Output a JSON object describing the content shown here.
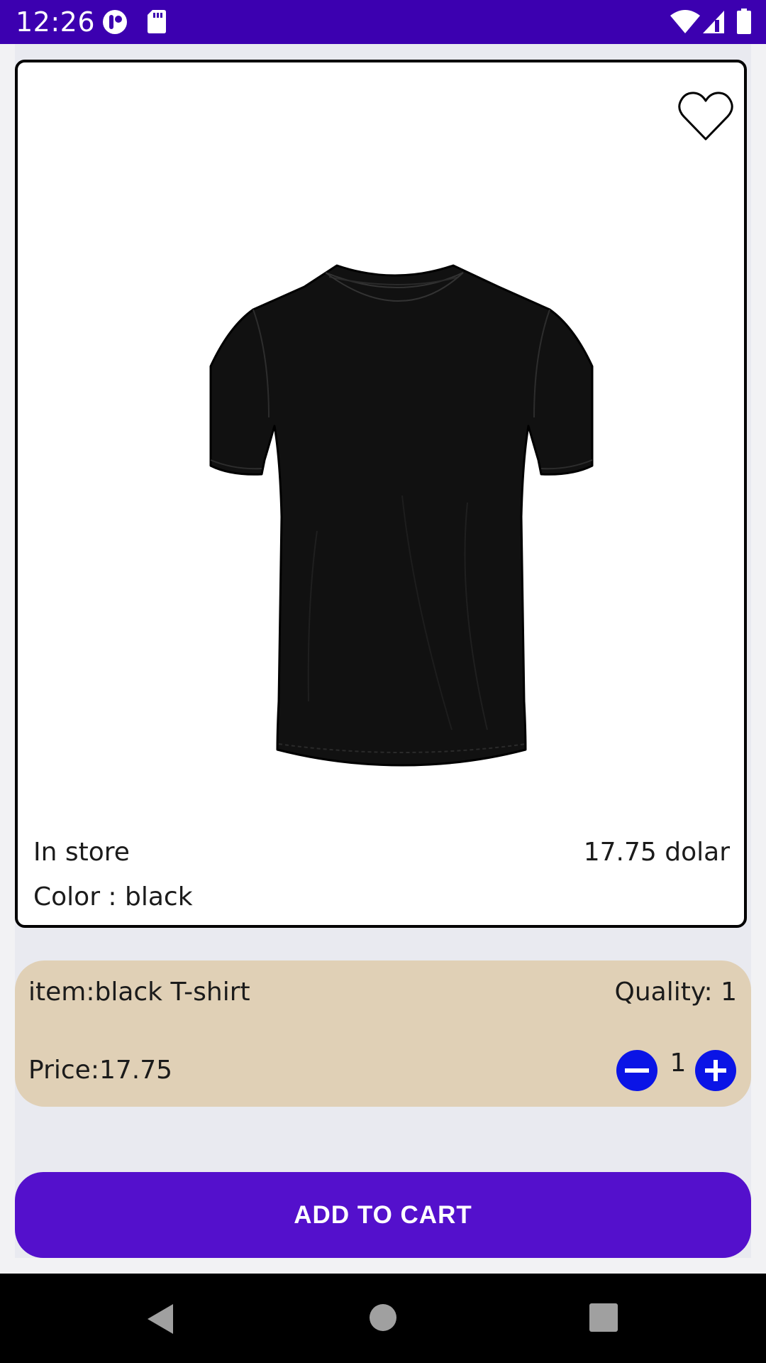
{
  "status_bar": {
    "time": "12:26",
    "left_icons": [
      "record-icon",
      "sd-card-icon"
    ],
    "right_icons": [
      "wifi-icon",
      "signal-icon",
      "battery-icon"
    ]
  },
  "product": {
    "stock_status": "In store",
    "price": "17.75 dolar",
    "color_line": "Color : black",
    "image": "black-tshirt-image",
    "favorite_icon": "heart-outline-icon"
  },
  "cart": {
    "item_label": "item:black T-shirt",
    "quality_label": "Quality: 1",
    "price_label": "Price:17.75",
    "quantity": "1",
    "decrement_icon": "minus-circle-icon",
    "increment_icon": "plus-circle-icon"
  },
  "actions": {
    "add_to_cart_label": "ADD TO CART"
  },
  "navigation": {
    "buttons": [
      "back-triangle-icon",
      "home-circle-icon",
      "recents-square-icon"
    ]
  },
  "colors": {
    "status_bar": "#3c00b0",
    "button_primary": "#5410cc",
    "cart_row": "#e0d0b6",
    "qty_buttons": "#0a14e6"
  }
}
